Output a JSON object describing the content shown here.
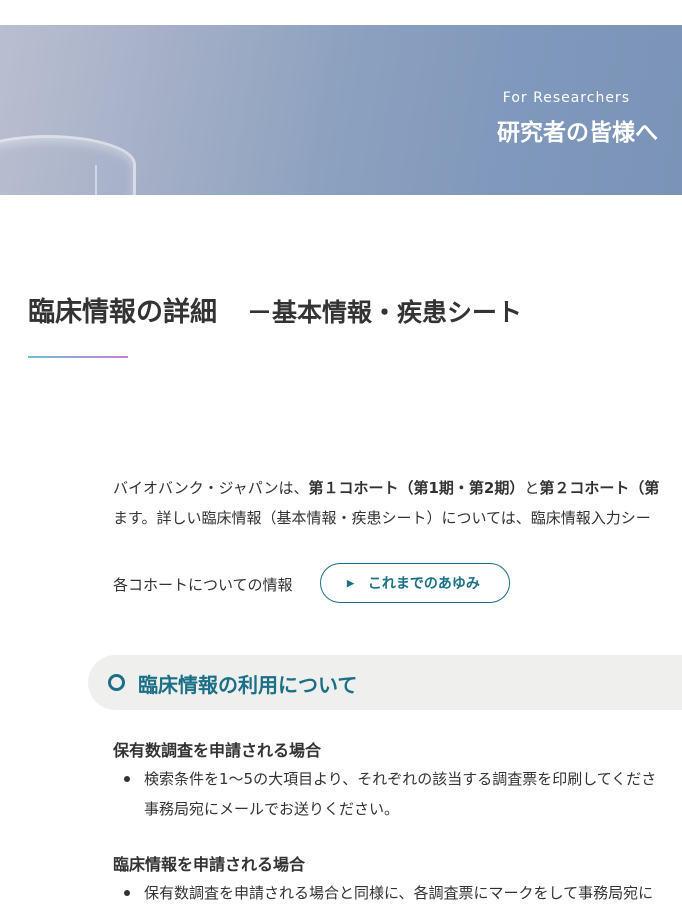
{
  "hero": {
    "subtitle": "For Researchers",
    "title": "研究者の皆様へ"
  },
  "page": {
    "title": "臨床情報の詳細",
    "subtitle": "－基本情報・疾患シート"
  },
  "intro": {
    "line1_a": "バイオバンク・ジャパンは、",
    "line1_b": "第１コホート（第1期・第2期）",
    "line1_c": "と",
    "line1_d": "第２コホート（第",
    "line2": "ます。詳しい臨床情報（基本情報・疾患シート）については、臨床情報入力シー"
  },
  "cohort": {
    "label": "各コホートについての情報",
    "button_label": "これまでのあゆみ"
  },
  "section": {
    "heading": "臨床情報の利用について",
    "blocks": [
      {
        "heading": "保有数調査を申請される場合",
        "line1": "検索条件を1～5の大項目より、それぞれの該当する調査票を印刷してくださ",
        "line2": "事務局宛にメールでお送りください。"
      },
      {
        "heading": "臨床情報を申請される場合",
        "line1": "保有数調査を申請される場合と同様に、各調査票にマークをして事務局宛に"
      }
    ]
  },
  "colors": {
    "accent": "#1b6f86",
    "section_bg": "#efefed",
    "text": "#333333"
  }
}
